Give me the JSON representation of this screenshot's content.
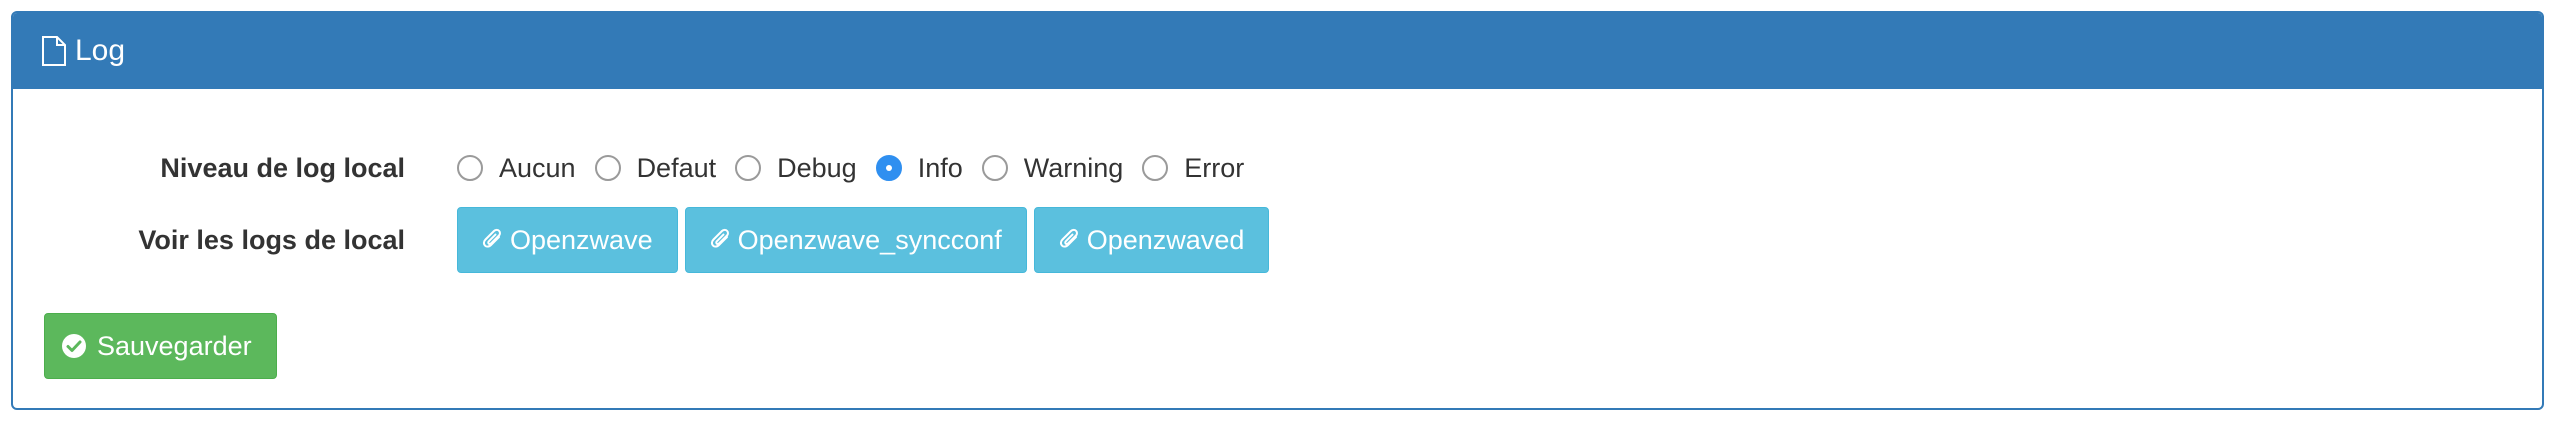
{
  "panel": {
    "title": "Log",
    "icon": "file-icon",
    "accent_color": "#337ab7"
  },
  "log_level": {
    "label": "Niveau de log local",
    "selected": "Info",
    "options": [
      {
        "label": "Aucun",
        "checked": false
      },
      {
        "label": "Defaut",
        "checked": false
      },
      {
        "label": "Debug",
        "checked": false
      },
      {
        "label": "Info",
        "checked": true
      },
      {
        "label": "Warning",
        "checked": false
      },
      {
        "label": "Error",
        "checked": false
      }
    ]
  },
  "logs": {
    "label": "Voir les logs de local",
    "buttons": [
      {
        "label": "Openzwave",
        "icon": "paperclip-icon"
      },
      {
        "label": "Openzwave_syncconf",
        "icon": "paperclip-icon"
      },
      {
        "label": "Openzwaved",
        "icon": "paperclip-icon"
      }
    ],
    "button_color": "#5bc0de"
  },
  "save": {
    "label": "Sauvegarder",
    "icon": "check-circle-icon",
    "color": "#5cb85c"
  }
}
